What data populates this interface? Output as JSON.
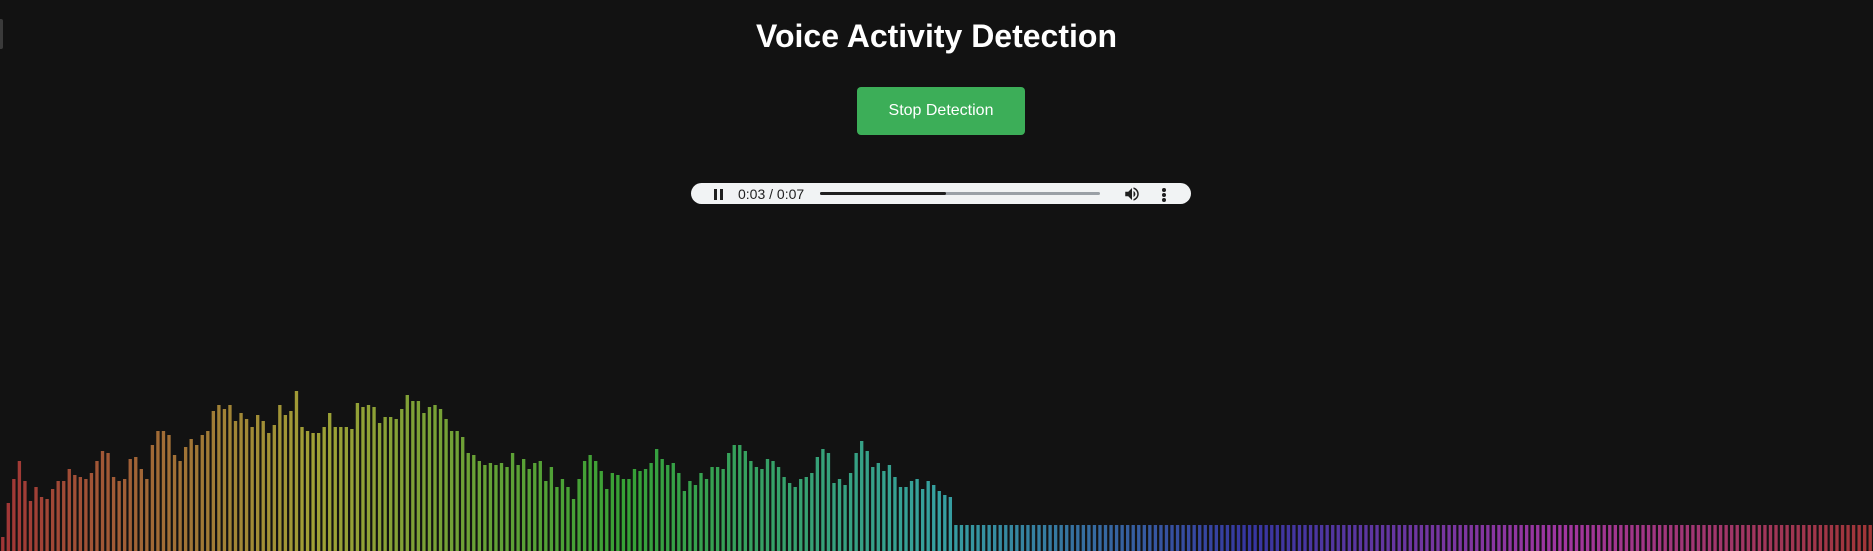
{
  "page": {
    "title": "Voice Activity Detection"
  },
  "controls": {
    "stop_button_label": "Stop Detection",
    "button_color": "#3cae58"
  },
  "audio_player": {
    "time_display": "0:03 / 0:07",
    "progress": 0.45,
    "play_state_icon": "pause-icon",
    "volume_icon": "volume-icon",
    "menu_icon": "more-vert-icon"
  },
  "visualizer": {
    "bar_count": 312,
    "max_level": 1.0,
    "levels": [
      0.07,
      0.24,
      0.36,
      0.45,
      0.35,
      0.25,
      0.32,
      0.27,
      0.26,
      0.31,
      0.35,
      0.35,
      0.41,
      0.38,
      0.37,
      0.36,
      0.39,
      0.45,
      0.5,
      0.49,
      0.37,
      0.35,
      0.36,
      0.46,
      0.47,
      0.41,
      0.36,
      0.53,
      0.6,
      0.6,
      0.58,
      0.48,
      0.45,
      0.52,
      0.56,
      0.53,
      0.58,
      0.6,
      0.7,
      0.73,
      0.71,
      0.73,
      0.65,
      0.69,
      0.66,
      0.62,
      0.68,
      0.65,
      0.59,
      0.63,
      0.73,
      0.68,
      0.7,
      0.8,
      0.62,
      0.6,
      0.59,
      0.59,
      0.62,
      0.69,
      0.62,
      0.62,
      0.62,
      0.61,
      0.74,
      0.72,
      0.73,
      0.72,
      0.64,
      0.67,
      0.67,
      0.66,
      0.71,
      0.78,
      0.75,
      0.75,
      0.69,
      0.72,
      0.73,
      0.71,
      0.66,
      0.6,
      0.6,
      0.57,
      0.49,
      0.48,
      0.45,
      0.43,
      0.44,
      0.43,
      0.44,
      0.42,
      0.49,
      0.43,
      0.46,
      0.41,
      0.44,
      0.45,
      0.35,
      0.42,
      0.32,
      0.36,
      0.32,
      0.26,
      0.36,
      0.45,
      0.48,
      0.45,
      0.4,
      0.31,
      0.39,
      0.38,
      0.36,
      0.36,
      0.41,
      0.4,
      0.41,
      0.44,
      0.51,
      0.46,
      0.43,
      0.44,
      0.39,
      0.3,
      0.35,
      0.33,
      0.39,
      0.36,
      0.42,
      0.42,
      0.41,
      0.49,
      0.53,
      0.53,
      0.5,
      0.45,
      0.42,
      0.41,
      0.46,
      0.45,
      0.42,
      0.37,
      0.34,
      0.32,
      0.36,
      0.37,
      0.39,
      0.47,
      0.51,
      0.49,
      0.34,
      0.36,
      0.33,
      0.39,
      0.49,
      0.55,
      0.5,
      0.42,
      0.44,
      0.4,
      0.43,
      0.37,
      0.32,
      0.32,
      0.35,
      0.36,
      0.31,
      0.35,
      0.33,
      0.3,
      0.28,
      0.27,
      0.13,
      0.13,
      0.13,
      0.13,
      0.13,
      0.13,
      0.13,
      0.13,
      0.13,
      0.13,
      0.13,
      0.13,
      0.13,
      0.13,
      0.13,
      0.13,
      0.13,
      0.13,
      0.13,
      0.13,
      0.13,
      0.13,
      0.13,
      0.13,
      0.13,
      0.13,
      0.13,
      0.13,
      0.13,
      0.13,
      0.13,
      0.13,
      0.13,
      0.13,
      0.13,
      0.13,
      0.13,
      0.13,
      0.13,
      0.13,
      0.13,
      0.13,
      0.13,
      0.13,
      0.13,
      0.13,
      0.13,
      0.13,
      0.13,
      0.13,
      0.13,
      0.13,
      0.13,
      0.13,
      0.13,
      0.13,
      0.13,
      0.13,
      0.13,
      0.13,
      0.13,
      0.13,
      0.13,
      0.13,
      0.13,
      0.13,
      0.13,
      0.13,
      0.13,
      0.13,
      0.13,
      0.13,
      0.13,
      0.13,
      0.13,
      0.13,
      0.13,
      0.13,
      0.13,
      0.13,
      0.13,
      0.13,
      0.13,
      0.13,
      0.13,
      0.13,
      0.13,
      0.13,
      0.13,
      0.13,
      0.13,
      0.13,
      0.13,
      0.13,
      0.13,
      0.13,
      0.13,
      0.13,
      0.13,
      0.13,
      0.13,
      0.13,
      0.13,
      0.13,
      0.13,
      0.13,
      0.13,
      0.13,
      0.13,
      0.13,
      0.13,
      0.13,
      0.13,
      0.13,
      0.13,
      0.13,
      0.13,
      0.13,
      0.13,
      0.13,
      0.13,
      0.13,
      0.13,
      0.13,
      0.13,
      0.13,
      0.13,
      0.13,
      0.13,
      0.13,
      0.13,
      0.13,
      0.13,
      0.13,
      0.13,
      0.13,
      0.13,
      0.13,
      0.13,
      0.13,
      0.13,
      0.13,
      0.13,
      0.13,
      0.13,
      0.13,
      0.13,
      0.13,
      0.13,
      0.13,
      0.13,
      0.13,
      0.13,
      0.13,
      0.13,
      0.13,
      0.13,
      0.13,
      0.13,
      0.13,
      0.13,
      0.13,
      0.13,
      0.13,
      0.13,
      0.13
    ]
  }
}
